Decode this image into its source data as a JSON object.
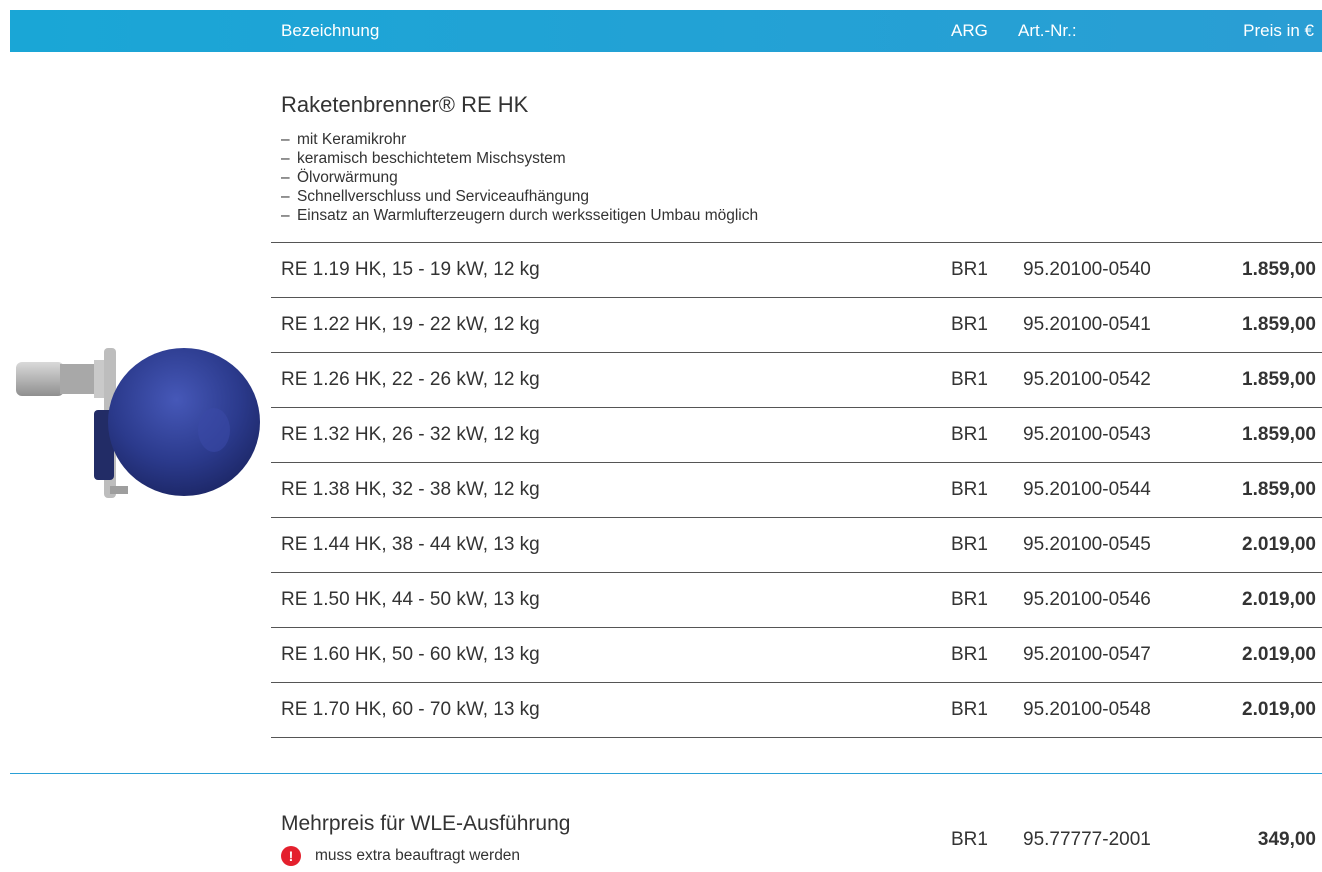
{
  "header": {
    "name": "Bezeichnung",
    "arg": "ARG",
    "art": "Art.-Nr.:",
    "price": "Preis in €"
  },
  "product": {
    "title": "Raketenbrenner® RE HK",
    "features": [
      "mit Keramikrohr",
      "keramisch beschichtetem Mischsystem",
      "Ölvorwärmung",
      "Schnellverschluss und Serviceaufhängung",
      "Einsatz an Warmlufterzeugern durch werksseitigen Umbau möglich"
    ],
    "rows": [
      {
        "name": "RE 1.19 HK, 15 - 19 kW, 12 kg",
        "arg": "BR1",
        "art": "95.20100-0540",
        "price": "1.859,00"
      },
      {
        "name": "RE 1.22 HK, 19 - 22 kW, 12 kg",
        "arg": "BR1",
        "art": "95.20100-0541",
        "price": "1.859,00"
      },
      {
        "name": "RE 1.26 HK, 22 - 26 kW, 12 kg",
        "arg": "BR1",
        "art": "95.20100-0542",
        "price": "1.859,00"
      },
      {
        "name": "RE 1.32 HK, 26 - 32 kW, 12 kg",
        "arg": "BR1",
        "art": "95.20100-0543",
        "price": "1.859,00"
      },
      {
        "name": "RE 1.38 HK, 32 - 38 kW, 12 kg",
        "arg": "BR1",
        "art": "95.20100-0544",
        "price": "1.859,00"
      },
      {
        "name": "RE 1.44 HK, 38 - 44 kW, 13 kg",
        "arg": "BR1",
        "art": "95.20100-0545",
        "price": "2.019,00"
      },
      {
        "name": "RE 1.50 HK, 44 - 50 kW, 13 kg",
        "arg": "BR1",
        "art": "95.20100-0546",
        "price": "2.019,00"
      },
      {
        "name": "RE 1.60 HK, 50 - 60 kW, 13 kg",
        "arg": "BR1",
        "art": "95.20100-0547",
        "price": "2.019,00"
      },
      {
        "name": "RE 1.70 HK, 60 - 70 kW, 13 kg",
        "arg": "BR1",
        "art": "95.20100-0548",
        "price": "2.019,00"
      }
    ]
  },
  "extra": {
    "title": "Mehrpreis für WLE-Ausführung",
    "note": "muss extra beauftragt werden",
    "icon": "warning-icon",
    "arg": "BR1",
    "art": "95.77777-2001",
    "price": "349,00"
  },
  "colors": {
    "header": "#1aa6d6",
    "burner": "#2b3a8c",
    "warning": "#e4202d"
  }
}
